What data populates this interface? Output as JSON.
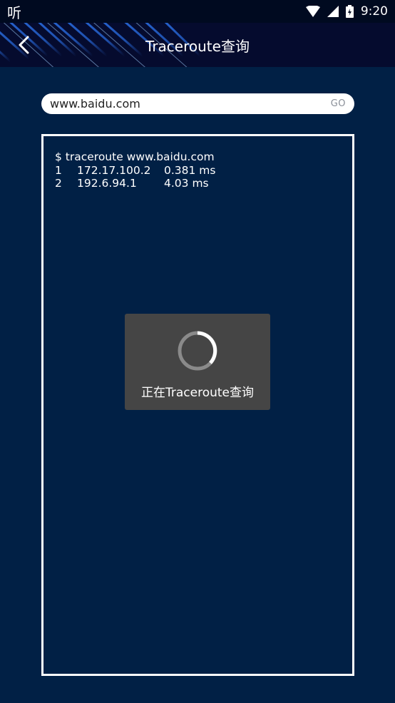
{
  "status_bar": {
    "left_text": "听",
    "time": "9:20",
    "icons": [
      "wifi-icon",
      "signal-icon",
      "battery-icon"
    ]
  },
  "header": {
    "title": "Traceroute查询",
    "back_icon": "chevron-left-icon"
  },
  "search": {
    "value": "www.baidu.com",
    "go_label": "GO"
  },
  "output": {
    "command": "$ traceroute www.baidu.com",
    "hops": [
      {
        "index": "1",
        "ip": "172.17.100.2",
        "time": "0.381 ms"
      },
      {
        "index": "2",
        "ip": "192.6.94.1",
        "time": "4.03 ms"
      }
    ]
  },
  "loading": {
    "text": "正在Traceroute查询"
  },
  "colors": {
    "background": "#012045",
    "header": "#050b2e",
    "stripe": "#2f7dff",
    "dialog": "#454545"
  }
}
